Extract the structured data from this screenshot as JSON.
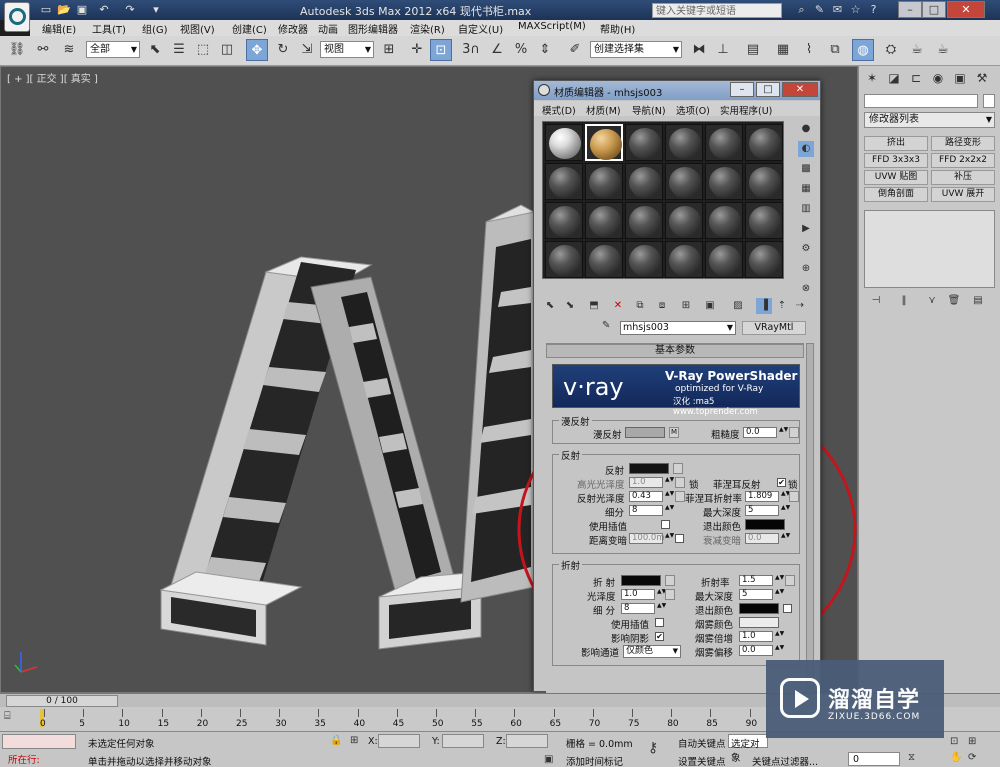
{
  "titlebar": {
    "title": "Autodesk 3ds Max  2012 x64     现代书柜.max",
    "search_placeholder": "键入关键字或短语"
  },
  "menubar": [
    "编辑(E)",
    "工具(T)",
    "组(G)",
    "视图(V)",
    "创建(C)",
    "修改器",
    "动画",
    "图形编辑器",
    "渲染(R)",
    "自定义(U)",
    "MAXScript(M)",
    "帮助(H)"
  ],
  "toolbar": {
    "selection_filter": "全部",
    "ref_coord": "视图",
    "named_selection": "创建选择集",
    "snap_number": "3",
    "percent_symbol": "%"
  },
  "viewport": {
    "label": "[ + ][ 正交 ][ 真实 ]"
  },
  "command_panel": {
    "modifier_list": "修改器列表",
    "buttons": [
      "挤出",
      "路径变形",
      "FFD 3x3x3",
      "FFD 2x2x2",
      "UVW 贴图",
      "补压",
      "倒角剖面",
      "UVW 展开"
    ]
  },
  "material_editor": {
    "title": "材质编辑器 - mhsjs003",
    "menus": [
      "模式(D)",
      "材质(M)",
      "导航(N)",
      "选项(O)",
      "实用程序(U)"
    ],
    "material_name": "mhsjs003",
    "material_type": "VRayMtl",
    "rollout_title": "基本参数",
    "vray_banner": {
      "logo": "v·ray",
      "product": "V-Ray PowerShader",
      "sub": "optimized for V-Ray",
      "hanhua": "汉化 :ma5  www.toprender.com"
    },
    "diffuse": {
      "group": "漫反射",
      "diffuse_label": "漫反射",
      "map_btn": "M",
      "roughness_label": "粗糙度",
      "roughness": "0.0"
    },
    "reflection": {
      "group": "反射",
      "reflect_label": "反射",
      "hilight_gloss_label": "高光光泽度",
      "hilight_gloss": "1.0",
      "lock": "锁",
      "fresnel_label": "菲涅耳反射",
      "fresnel_lock": "锁",
      "refl_gloss_label": "反射光泽度",
      "refl_gloss": "0.43",
      "fresnel_ior_label": "菲涅耳折射率",
      "fresnel_ior": "1.809",
      "subdivs_label": "细分",
      "subdivs": "8",
      "max_depth_label": "最大深度",
      "max_depth": "5",
      "use_interp_label": "使用插值",
      "exit_color_label": "退出颜色",
      "dim_dist_label": "距离变暗",
      "dim_dist": "100.0m",
      "dim_falloff_label": "衰减变暗",
      "dim_falloff": "0.0"
    },
    "refraction": {
      "group": "折射",
      "refract_label": "折 射",
      "ior_label": "折射率",
      "ior": "1.5",
      "gloss_label": "光泽度",
      "gloss": "1.0",
      "max_depth_label": "最大深度",
      "max_depth": "5",
      "subdivs_label": "细 分",
      "subdivs": "8",
      "exit_color_label": "退出颜色",
      "use_interp_label": "使用插值",
      "fog_color_label": "烟雾颜色",
      "affect_shadows_label": "影响阴影",
      "fog_mult_label": "烟雾倍增",
      "fog_mult": "1.0",
      "affect_channels_label": "影响通道",
      "affect_channels": "仅颜色",
      "fog_bias_label": "烟雾偏移",
      "fog_bias": "0.0"
    }
  },
  "timeline": {
    "frame": "0 / 100",
    "ticks": [
      "0",
      "5",
      "10",
      "15",
      "20",
      "25",
      "30",
      "35",
      "40",
      "45",
      "50",
      "55",
      "60",
      "65",
      "70",
      "75",
      "80",
      "85",
      "90"
    ]
  },
  "statusbar": {
    "mode": "所在行:",
    "status1": "未选定任何对象",
    "status2": "单击并拖动以选择并移动对象",
    "x_label": "X:",
    "y_label": "Y:",
    "z_label": "Z:",
    "grid": "栅格 = 0.0mm",
    "add_time_tag": "添加时间标记",
    "auto_key": "自动关键点",
    "selected_obj": "选定对象",
    "set_key": "设置关键点",
    "key_filter": "关键点过滤器...",
    "frame_field": "0"
  },
  "watermark": {
    "name": "溜溜自学",
    "url": "ZIXUE.3D66.COM"
  }
}
